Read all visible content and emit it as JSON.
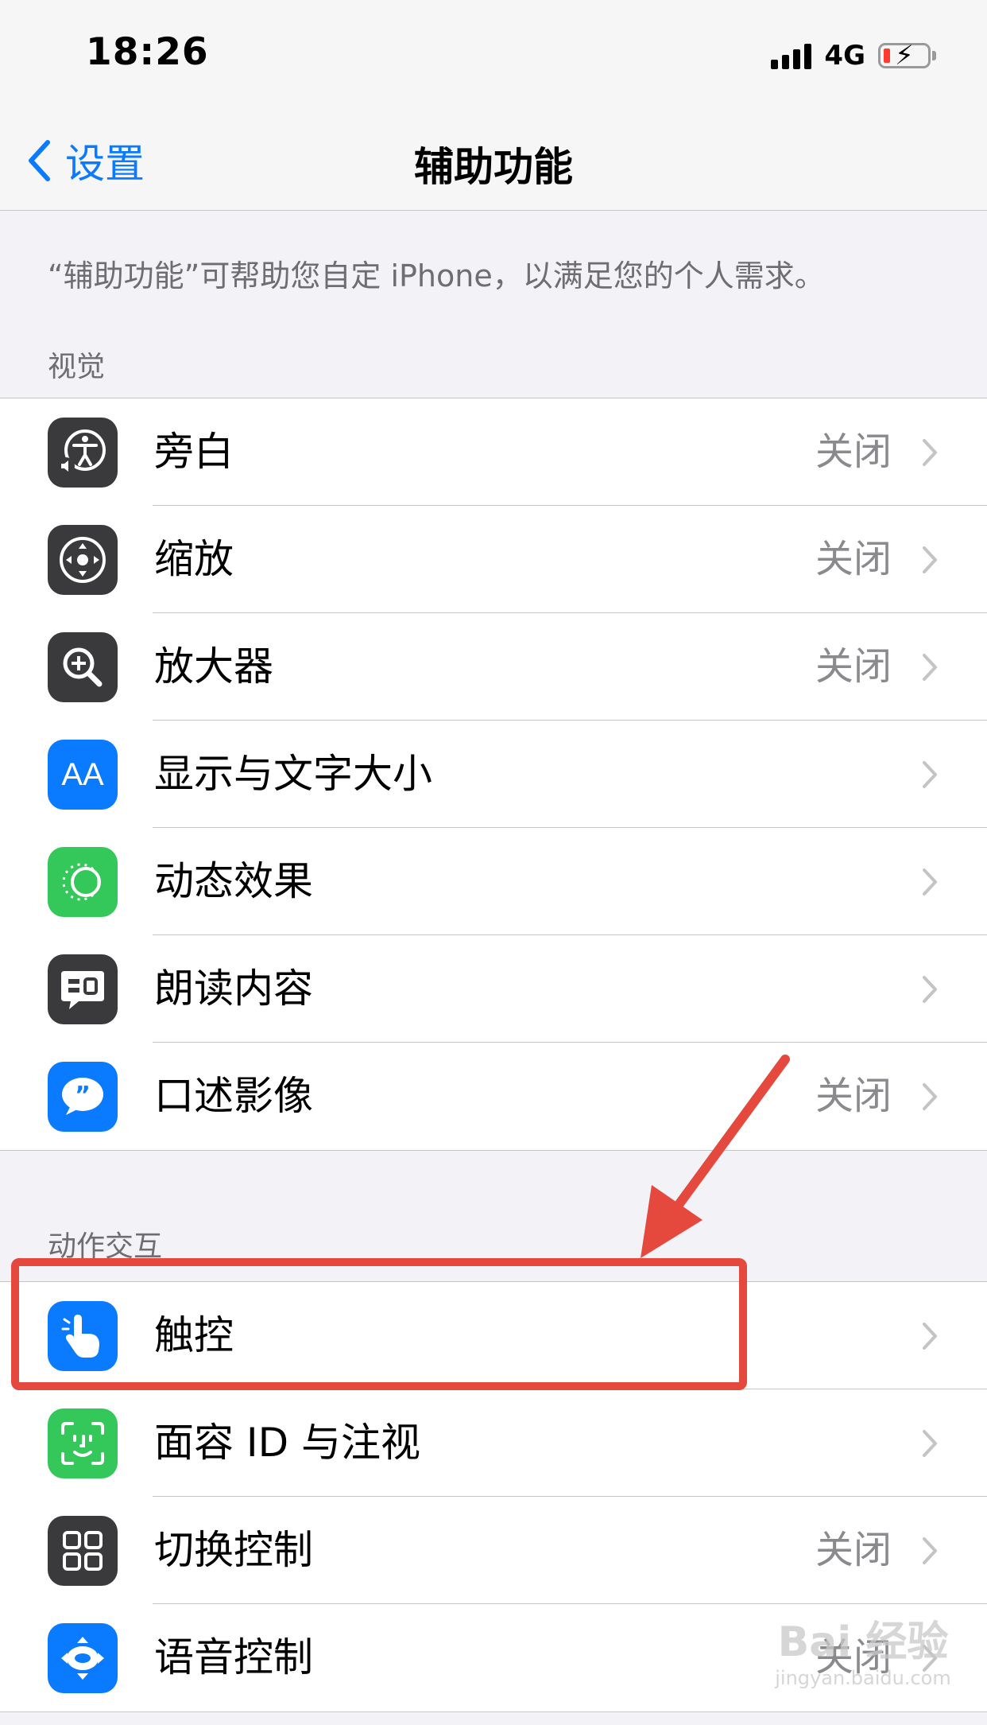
{
  "status_bar": {
    "time": "18:26",
    "network": "4G"
  },
  "nav": {
    "back_label": "设置",
    "title": "辅助功能"
  },
  "description": "“辅助功能”可帮助您自定 iPhone，以满足您的个人需求。",
  "sections": {
    "vision": {
      "header": "视觉",
      "rows": [
        {
          "label": "旁白",
          "value": "关闭",
          "icon": "voiceover-icon"
        },
        {
          "label": "缩放",
          "value": "关闭",
          "icon": "zoom-icon"
        },
        {
          "label": "放大器",
          "value": "关闭",
          "icon": "magnifier-icon"
        },
        {
          "label": "显示与文字大小",
          "value": "",
          "icon": "text-size-icon"
        },
        {
          "label": "动态效果",
          "value": "",
          "icon": "motion-icon"
        },
        {
          "label": "朗读内容",
          "value": "",
          "icon": "spoken-content-icon"
        },
        {
          "label": "口述影像",
          "value": "关闭",
          "icon": "audio-description-icon"
        }
      ]
    },
    "interaction": {
      "header": "动作交互",
      "rows": [
        {
          "label": "触控",
          "value": "",
          "icon": "touch-icon"
        },
        {
          "label": "面容 ID 与注视",
          "value": "",
          "icon": "face-id-icon"
        },
        {
          "label": "切换控制",
          "value": "关闭",
          "icon": "switch-control-icon"
        },
        {
          "label": "语音控制",
          "value": "关闭",
          "icon": "voice-control-icon"
        }
      ]
    }
  },
  "watermark": {
    "main": "Bai 经验",
    "sub": "jingyan.baidu.com"
  },
  "colors": {
    "accent": "#0a7aff",
    "highlight": "#e5483c",
    "green": "#34c759",
    "gray_icon": "#3a3a3c"
  }
}
